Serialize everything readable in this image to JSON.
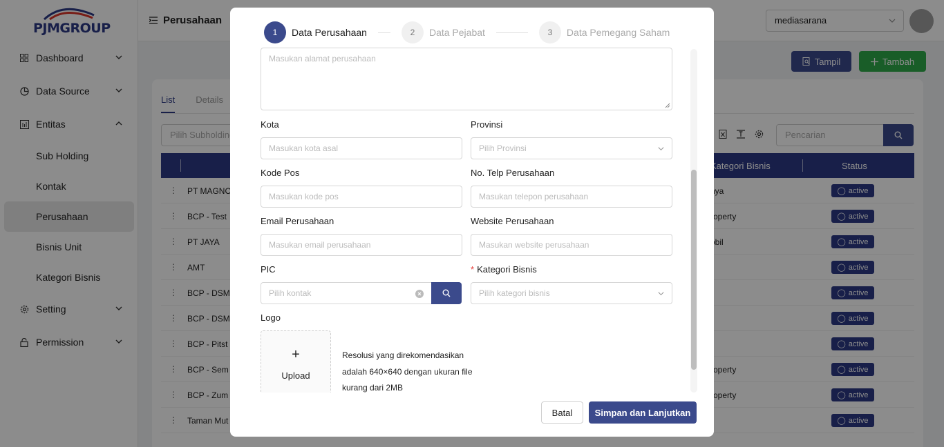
{
  "brand": {
    "name": "PJMGROUP"
  },
  "sidebar": {
    "items": [
      {
        "label": "Dashboard"
      },
      {
        "label": "Data Source"
      },
      {
        "label": "Entitas"
      },
      {
        "label": "Setting"
      },
      {
        "label": "Permission"
      }
    ],
    "entitas_sub": [
      {
        "label": "Sub Holding"
      },
      {
        "label": "Kontak"
      },
      {
        "label": "Perusahaan"
      },
      {
        "label": "Bisnis Unit"
      },
      {
        "label": "Kategori Bisnis"
      }
    ]
  },
  "header": {
    "title": "Perusahaan",
    "org_select": "mediasarana"
  },
  "toolbar": {
    "tampil_label": "Tampil",
    "tambah_label": "Tambah"
  },
  "page": {
    "tabs": [
      {
        "label": "List"
      },
      {
        "label": "Details"
      }
    ],
    "filter_placeholder": "Pilih Subholding",
    "search_placeholder": "Pencarian",
    "columns": {
      "kategori": "Kategori Bisnis",
      "status": "Status"
    },
    "rows": [
      {
        "name": "PT MAGNO",
        "kategori": "nya",
        "status": "active"
      },
      {
        "name": "BCP - Test",
        "kategori": "roperty",
        "status": "active"
      },
      {
        "name": "PT JAYA",
        "kategori": "obil",
        "status": "active"
      },
      {
        "name": "AMT",
        "kategori": "",
        "status": "active"
      },
      {
        "name": "BCP - DSM",
        "kategori": "",
        "status": "active"
      },
      {
        "name": "BCP - DSM",
        "kategori": "",
        "status": "active"
      },
      {
        "name": "BCP - Pitst",
        "kategori": "",
        "status": "active"
      },
      {
        "name": "BCP - Sem",
        "kategori": "roperty",
        "status": "active"
      },
      {
        "name": "BCP - Zum",
        "kategori": "roperty",
        "status": "active"
      },
      {
        "name": "Taman Mut",
        "kategori": "",
        "status": "active"
      }
    ]
  },
  "modal": {
    "steps": [
      {
        "num": "1",
        "label": "Data Perusahaan"
      },
      {
        "num": "2",
        "label": "Data Pejabat"
      },
      {
        "num": "3",
        "label": "Data Pemegang Saham"
      }
    ],
    "alamat_placeholder": "Masukan alamat perusahaan",
    "kota": {
      "label": "Kota",
      "placeholder": "Masukan kota asal"
    },
    "provinsi": {
      "label": "Provinsi",
      "placeholder": "Pilih Provinsi"
    },
    "kodepos": {
      "label": "Kode Pos",
      "placeholder": "Masukan kode pos"
    },
    "telp": {
      "label": "No. Telp Perusahaan",
      "placeholder": "Masukan telepon perusahaan"
    },
    "email": {
      "label": "Email Perusahaan",
      "placeholder": "Masukan email perusahaan"
    },
    "website": {
      "label": "Website Perusahaan",
      "placeholder": "Masukan website perusahaan"
    },
    "pic": {
      "label": "PIC",
      "placeholder": "Pilih kontak"
    },
    "kategori": {
      "required_mark": "*",
      "label": "Kategori Bisnis",
      "placeholder": "Pilih kategori bisnis"
    },
    "logo": {
      "label": "Logo",
      "upload_plus": "+",
      "upload_label": "Upload",
      "hint": "Resolusi yang direkomendasikan adalah 640×640 dengan ukuran file kurang dari 2MB"
    },
    "batal_label": "Batal",
    "simpan_label": "Simpan dan Lanjutkan"
  },
  "colors": {
    "primary": "#3b4a8c",
    "success": "#2faa4a",
    "header_bg": "#2c3a85"
  }
}
